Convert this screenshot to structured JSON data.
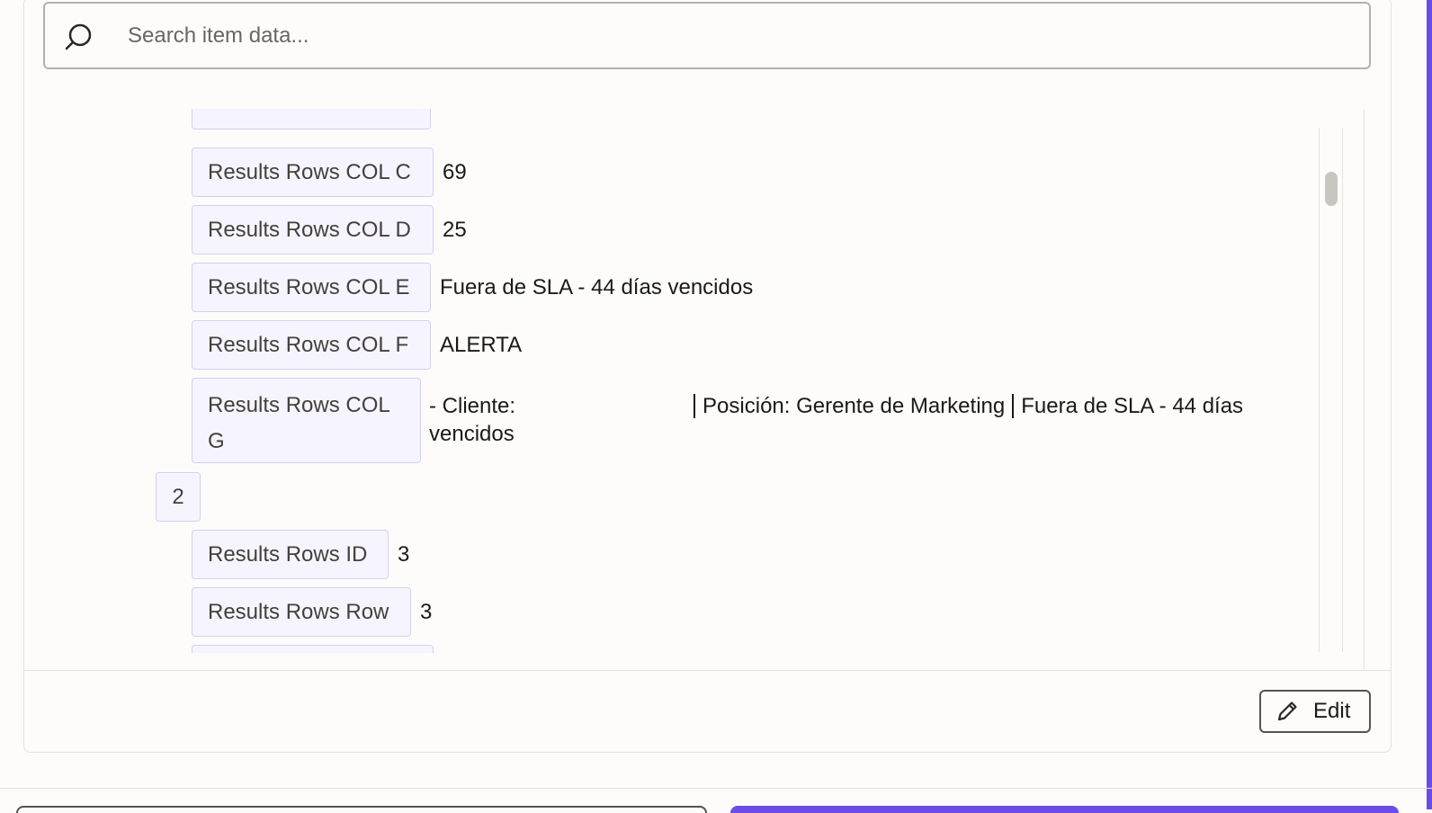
{
  "search": {
    "placeholder": "Search item data..."
  },
  "rows": [
    {
      "key": "Results Rows COL C",
      "value": "69"
    },
    {
      "key": "Results Rows COL D",
      "value": "25"
    },
    {
      "key": "Results Rows COL E",
      "value": "Fuera de SLA - 44 días vencidos"
    },
    {
      "key": "Results Rows COL F",
      "value": "ALERTA"
    },
    {
      "key": "Results Rows COL G",
      "value_parts": [
        "- Cliente:",
        "Posición: Gerente de Marketing",
        "Fuera de SLA - 44 días vencidos"
      ]
    }
  ],
  "group2": {
    "index": "2",
    "rows": [
      {
        "key": "Results Rows ID",
        "value": "3"
      },
      {
        "key": "Results Rows Row",
        "value": "3"
      }
    ]
  },
  "footer": {
    "edit_label": "Edit"
  },
  "colors": {
    "accent": "#6b4ce6",
    "key_bg": "#f6f5ff",
    "key_border": "#d3d0f2"
  }
}
